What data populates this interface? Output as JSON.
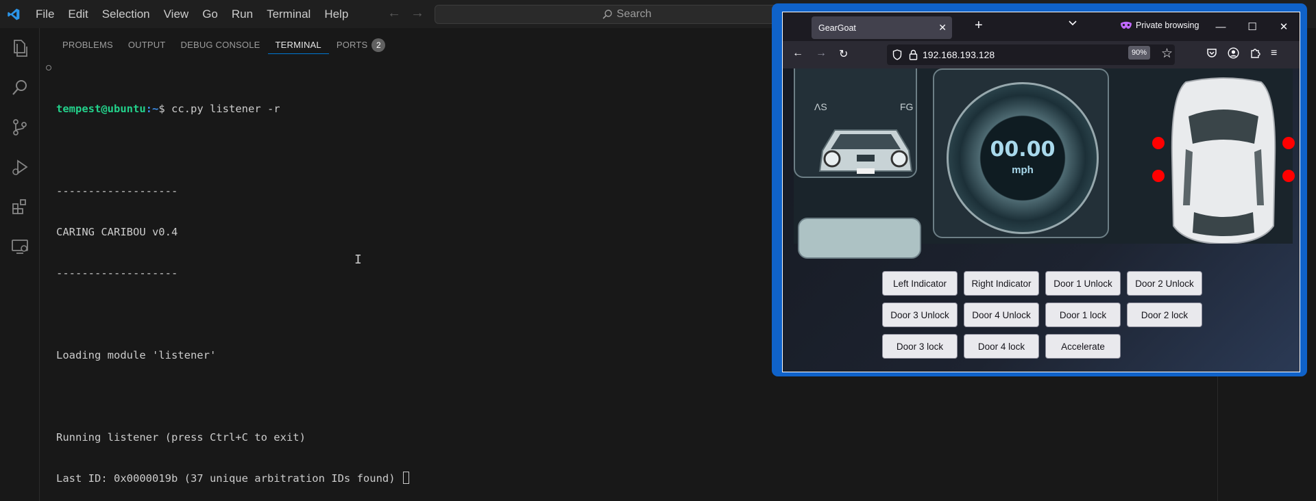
{
  "menu": [
    "File",
    "Edit",
    "Selection",
    "View",
    "Go",
    "Run",
    "Terminal",
    "Help"
  ],
  "command_center": {
    "placeholder": "Search"
  },
  "panel": {
    "tabs": [
      {
        "label": "PROBLEMS"
      },
      {
        "label": "OUTPUT"
      },
      {
        "label": "DEBUG CONSOLE"
      },
      {
        "label": "TERMINAL"
      },
      {
        "label": "PORTS",
        "badge": "2"
      }
    ],
    "active_tab": "TERMINAL"
  },
  "terminal": {
    "prompt_user": "tempest@ubuntu",
    "prompt_path": ":~",
    "prompt_sign": "$ ",
    "command": "cc.py listener -r",
    "lines": [
      "",
      "-------------------",
      "CARING CARIBOU v0.4",
      "-------------------",
      "",
      "Loading module 'listener'",
      "",
      "Running listener (press Ctrl+C to exit)",
      "Last ID: 0x0000019b (37 unique arbitration IDs found) "
    ]
  },
  "browser": {
    "tab_title": "GearGoat",
    "private_label": "Private browsing",
    "url": "192.168.193.128",
    "zoom": "90%",
    "gauge": {
      "value": "00.00",
      "unit": "mph"
    },
    "dash_labels": {
      "left": "ΛЅ",
      "right": "FG"
    },
    "buttons": [
      "Left Indicator",
      "Right Indicator",
      "Door 1 Unlock",
      "Door 2 Unlock",
      "Door 3 Unlock",
      "Door 4 Unlock",
      "Door 1 lock",
      "Door 2 lock",
      "Door 3 lock",
      "Door 4 lock",
      "Accelerate"
    ]
  },
  "colors": {
    "accent": "#0078d4",
    "prompt_user": "#23d18b",
    "prompt_path": "#3b8eea",
    "browser_frame": "#0f62c9",
    "door_dot": "#ff0000"
  }
}
